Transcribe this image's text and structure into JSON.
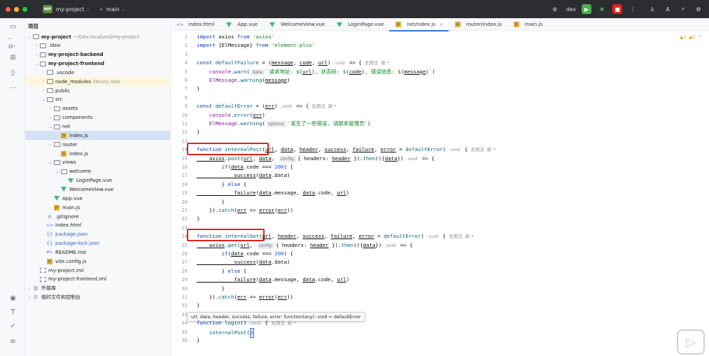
{
  "titlebar": {
    "project_badge": "MP",
    "project_name": "my-project",
    "branch": "main",
    "run_config": "dev",
    "colors": {
      "bg": "#2b2d30",
      "run": "#4caf50",
      "debug": "#e0231b"
    }
  },
  "project": {
    "title": "项目",
    "tree": [
      {
        "label": "my-project",
        "hint": "~/Dev.localized/my-project",
        "depth": 0,
        "kind": "folder",
        "chev": "open",
        "bold": true
      },
      {
        "label": ".idea",
        "depth": 1,
        "kind": "folder",
        "chev": "closed"
      },
      {
        "label": "my-project-backend",
        "depth": 1,
        "kind": "folder",
        "chev": "closed",
        "bold": true
      },
      {
        "label": "my-project-frontend",
        "depth": 1,
        "kind": "folder",
        "chev": "open",
        "bold": true
      },
      {
        "label": ".vscode",
        "depth": 2,
        "kind": "folder",
        "chev": "closed"
      },
      {
        "label": "node_modules",
        "hint": "library root",
        "depth": 2,
        "kind": "folder",
        "chev": "closed",
        "hl": true
      },
      {
        "label": "public",
        "depth": 2,
        "kind": "folder",
        "chev": "closed"
      },
      {
        "label": "src",
        "depth": 2,
        "kind": "folder",
        "chev": "open"
      },
      {
        "label": "assets",
        "depth": 3,
        "kind": "folder",
        "chev": "closed"
      },
      {
        "label": "components",
        "depth": 3,
        "kind": "folder",
        "chev": "closed"
      },
      {
        "label": "net",
        "depth": 3,
        "kind": "folder",
        "chev": "open"
      },
      {
        "label": "index.js",
        "depth": 4,
        "kind": "js",
        "sel": true
      },
      {
        "label": "router",
        "depth": 3,
        "kind": "folder",
        "chev": "open"
      },
      {
        "label": "index.js",
        "depth": 4,
        "kind": "js"
      },
      {
        "label": "views",
        "depth": 3,
        "kind": "folder",
        "chev": "open"
      },
      {
        "label": "welcome",
        "depth": 4,
        "kind": "folder",
        "chev": "open"
      },
      {
        "label": "LoginPage.vue",
        "depth": 5,
        "kind": "vue"
      },
      {
        "label": "WelcomeView.vue",
        "depth": 4,
        "kind": "vue"
      },
      {
        "label": "App.vue",
        "depth": 3,
        "kind": "vue"
      },
      {
        "label": "main.js",
        "depth": 3,
        "kind": "js"
      },
      {
        "label": ".gitignore",
        "depth": 2,
        "kind": "ignore"
      },
      {
        "label": "index.html",
        "depth": 2,
        "kind": "html"
      },
      {
        "label": "package.json",
        "depth": 2,
        "kind": "json",
        "blue": true
      },
      {
        "label": "package-lock.json",
        "depth": 2,
        "kind": "json",
        "blue": true
      },
      {
        "label": "README.md",
        "depth": 2,
        "kind": "md"
      },
      {
        "label": "vite.config.js",
        "depth": 2,
        "kind": "js"
      },
      {
        "label": "my-project.iml",
        "depth": 1,
        "kind": "iml"
      },
      {
        "label": "my-project-frontend.iml",
        "depth": 1,
        "kind": "iml"
      },
      {
        "label": "外部库",
        "depth": 0,
        "kind": "lib",
        "chev": "closed"
      },
      {
        "label": "临时文件和控制台",
        "depth": 0,
        "kind": "scratch",
        "chev": "closed"
      }
    ]
  },
  "tabs": [
    {
      "label": "index.html",
      "kind": "html"
    },
    {
      "label": "App.vue",
      "kind": "vue"
    },
    {
      "label": "WelcomeView.vue",
      "kind": "vue"
    },
    {
      "label": "LoginPage.vue",
      "kind": "vue"
    },
    {
      "label": "net/index.js",
      "kind": "js",
      "active": true
    },
    {
      "label": "router/index.js",
      "kind": "js"
    },
    {
      "label": "main.js",
      "kind": "js"
    }
  ],
  "editor": {
    "inspection": {
      "warnings": "▲3",
      "weak": "▲1"
    },
    "line_numbers": [
      "1",
      "2",
      "3",
      "4",
      "5",
      "6",
      "7",
      "8",
      "9",
      "10",
      "11",
      "12",
      "13",
      "14",
      "15",
      "16",
      "17",
      "18",
      "19",
      "20",
      "21",
      "22",
      "23",
      "24",
      "25",
      "26",
      "27",
      "28",
      "29",
      "30",
      "31",
      "32",
      "33",
      "34",
      "35",
      "36"
    ],
    "lines": [
      [
        {
          "t": "import ",
          "c": "kw"
        },
        {
          "t": "axios "
        },
        {
          "t": "from ",
          "c": "kw"
        },
        {
          "t": "'axios'",
          "c": "str"
        }
      ],
      [
        {
          "t": "import ",
          "c": "kw"
        },
        {
          "t": "{ElMessage} "
        },
        {
          "t": "from ",
          "c": "kw"
        },
        {
          "t": "'element-plus'",
          "c": "str"
        }
      ],
      [],
      [
        {
          "t": "const ",
          "c": "kw"
        },
        {
          "t": "defaultFailure",
          "c": "fn"
        },
        {
          "t": " = ("
        },
        {
          "t": "message",
          "c": "ul"
        },
        {
          "t": ", "
        },
        {
          "t": "code",
          "c": "ul"
        },
        {
          "t": ", "
        },
        {
          "t": "url",
          "c": "ul"
        },
        {
          "t": ")"
        },
        {
          "t": " : void ",
          "c": "inlay"
        },
        {
          "t": " => {"
        },
        {
          "t": "  无用法  新 *",
          "c": "inlay"
        }
      ],
      [
        {
          "t": "    console",
          "c": "pur"
        },
        {
          "t": "."
        },
        {
          "t": "warn",
          "c": "fn"
        },
        {
          "t": "("
        },
        {
          "h": "data:"
        },
        {
          "t": "`请求地址: ${",
          "c": "str"
        },
        {
          "t": "url",
          "c": "ul"
        },
        {
          "t": "}, 状态码: ${",
          "c": "str"
        },
        {
          "t": "code",
          "c": "ul"
        },
        {
          "t": "}, 错误信息: ${",
          "c": "str"
        },
        {
          "t": "message",
          "c": "ul"
        },
        {
          "t": "}`",
          "c": "str"
        },
        {
          "t": ")"
        }
      ],
      [
        {
          "t": "    ElMessage",
          "c": "pur"
        },
        {
          "t": "."
        },
        {
          "t": "warning",
          "c": "fn"
        },
        {
          "t": "("
        },
        {
          "t": "message",
          "c": "ul"
        },
        {
          "t": ")"
        }
      ],
      [
        {
          "t": "}"
        }
      ],
      [],
      [
        {
          "t": "const ",
          "c": "kw"
        },
        {
          "t": "defaultError",
          "c": "fn"
        },
        {
          "t": " = ("
        },
        {
          "t": "err",
          "c": "ul"
        },
        {
          "t": ")"
        },
        {
          "t": " : void ",
          "c": "inlay"
        },
        {
          "t": " => {"
        },
        {
          "t": "  无用法  新 *",
          "c": "inlay"
        }
      ],
      [
        {
          "t": "    console",
          "c": "pur"
        },
        {
          "t": "."
        },
        {
          "t": "error",
          "c": "fn"
        },
        {
          "t": "("
        },
        {
          "t": "err",
          "c": "ul"
        },
        {
          "t": ")"
        }
      ],
      [
        {
          "t": "    ElMessage",
          "c": "pur"
        },
        {
          "t": "."
        },
        {
          "t": "warning",
          "c": "fn"
        },
        {
          "t": "("
        },
        {
          "h": "options:"
        },
        {
          "t": "'发生了一些错误, 请联系管理员'",
          "c": "str"
        },
        {
          "t": ")"
        }
      ],
      [
        {
          "t": "}"
        }
      ],
      [],
      [
        {
          "t": "function ",
          "c": "kw"
        },
        {
          "t": "internalPost",
          "c": "fn"
        },
        {
          "t": "("
        },
        {
          "t": "url",
          "c": "ul"
        },
        {
          "t": ", "
        },
        {
          "t": "data",
          "c": "ul"
        },
        {
          "t": ", "
        },
        {
          "t": "header",
          "c": "ul"
        },
        {
          "t": ", "
        },
        {
          "t": "success",
          "c": "ul"
        },
        {
          "t": ", "
        },
        {
          "t": "failure",
          "c": "ul"
        },
        {
          "t": ", "
        },
        {
          "t": "error",
          "c": "ul"
        },
        {
          "t": " = "
        },
        {
          "t": "defaultError",
          "c": "fn"
        },
        {
          "t": ")"
        },
        {
          "t": " : void ",
          "c": "inlay"
        },
        {
          "t": " {"
        },
        {
          "t": "  无用法  新 *",
          "c": "inlay"
        }
      ],
      [
        {
          "t": "    axios",
          "c": "ul"
        },
        {
          "t": "."
        },
        {
          "t": "post",
          "c": "fn"
        },
        {
          "t": "("
        },
        {
          "t": "url",
          "c": "ul"
        },
        {
          "t": ", "
        },
        {
          "t": "data",
          "c": "ul"
        },
        {
          "t": ", "
        },
        {
          "h": "config:"
        },
        {
          "t": "{ headers: "
        },
        {
          "t": "header",
          "c": "ul"
        },
        {
          "t": " })."
        },
        {
          "t": "then",
          "c": "fn"
        },
        {
          "t": "(({"
        },
        {
          "t": "data",
          "c": "ul"
        },
        {
          "t": "})"
        },
        {
          "t": " : void ",
          "c": "inlay"
        },
        {
          "t": " => {"
        }
      ],
      [
        {
          "t": "        if",
          "c": "kw"
        },
        {
          "t": "("
        },
        {
          "t": "data",
          "c": "ul"
        },
        {
          "t": ".code === "
        },
        {
          "t": "200",
          "c": "num"
        },
        {
          "t": ") {"
        }
      ],
      [
        {
          "t": "            success",
          "c": "ul"
        },
        {
          "t": "("
        },
        {
          "t": "data",
          "c": "ul"
        },
        {
          "t": ".data)"
        }
      ],
      [
        {
          "t": "        } "
        },
        {
          "t": "else ",
          "c": "kw"
        },
        {
          "t": "{"
        }
      ],
      [
        {
          "t": "            failure",
          "c": "ul"
        },
        {
          "t": "("
        },
        {
          "t": "data",
          "c": "ul"
        },
        {
          "t": ".message, "
        },
        {
          "t": "data",
          "c": "ul"
        },
        {
          "t": ".code, "
        },
        {
          "t": "url",
          "c": "ul"
        },
        {
          "t": ")"
        }
      ],
      [
        {
          "t": "        }"
        }
      ],
      [
        {
          "t": "    })."
        },
        {
          "t": "catch",
          "c": "fn"
        },
        {
          "t": "("
        },
        {
          "t": "err",
          "c": "ul"
        },
        {
          "t": " => "
        },
        {
          "t": "error",
          "c": "ul"
        },
        {
          "t": "("
        },
        {
          "t": "err",
          "c": "ul"
        },
        {
          "t": "))"
        }
      ],
      [
        {
          "t": "}"
        }
      ],
      [],
      [
        {
          "t": "function ",
          "c": "kw"
        },
        {
          "t": "internalGet",
          "c": "fn"
        },
        {
          "t": "("
        },
        {
          "t": "url",
          "c": "ul"
        },
        {
          "t": ", "
        },
        {
          "t": "header",
          "c": "ul"
        },
        {
          "t": ", "
        },
        {
          "t": "success",
          "c": "ul"
        },
        {
          "t": ", "
        },
        {
          "t": "failure",
          "c": "ul"
        },
        {
          "t": ", "
        },
        {
          "t": "error",
          "c": "ul"
        },
        {
          "t": " = "
        },
        {
          "t": "defaultError",
          "c": "fn"
        },
        {
          "t": ")"
        },
        {
          "t": " : void ",
          "c": "inlay"
        },
        {
          "t": " {"
        },
        {
          "t": "  无用法  新 *",
          "c": "inlay"
        }
      ],
      [
        {
          "t": "    axios",
          "c": "ul"
        },
        {
          "t": "."
        },
        {
          "t": "get",
          "c": "fn"
        },
        {
          "t": "("
        },
        {
          "t": "url",
          "c": "ul"
        },
        {
          "t": ", "
        },
        {
          "h": "config:"
        },
        {
          "t": "{ headers: "
        },
        {
          "t": "header",
          "c": "ul"
        },
        {
          "t": " })."
        },
        {
          "t": "then",
          "c": "fn"
        },
        {
          "t": "(({"
        },
        {
          "t": "data",
          "c": "ul"
        },
        {
          "t": "})"
        },
        {
          "t": " : void ",
          "c": "inlay"
        },
        {
          "t": " => {"
        }
      ],
      [
        {
          "t": "        if",
          "c": "kw"
        },
        {
          "t": "("
        },
        {
          "t": "data",
          "c": "ul"
        },
        {
          "t": ".code === "
        },
        {
          "t": "200",
          "c": "num"
        },
        {
          "t": ") {"
        }
      ],
      [
        {
          "t": "            success",
          "c": "ul"
        },
        {
          "t": "("
        },
        {
          "t": "data",
          "c": "ul"
        },
        {
          "t": ".data)"
        }
      ],
      [
        {
          "t": "        } "
        },
        {
          "t": "else ",
          "c": "kw"
        },
        {
          "t": "{"
        }
      ],
      [
        {
          "t": "            failure",
          "c": "ul"
        },
        {
          "t": "("
        },
        {
          "t": "data",
          "c": "ul"
        },
        {
          "t": ".message, "
        },
        {
          "t": "data",
          "c": "ul"
        },
        {
          "t": ".code, "
        },
        {
          "t": "url",
          "c": "ul"
        },
        {
          "t": ")"
        }
      ],
      [
        {
          "t": "        }"
        }
      ],
      [
        {
          "t": "    })."
        },
        {
          "t": "catch",
          "c": "fn"
        },
        {
          "t": "("
        },
        {
          "t": "err",
          "c": "ul"
        },
        {
          "t": " => "
        },
        {
          "t": "error",
          "c": "ul"
        },
        {
          "t": "("
        },
        {
          "t": "err",
          "c": "ul"
        },
        {
          "t": "))"
        }
      ],
      [
        {
          "t": "}"
        }
      ],
      [],
      [
        {
          "t": "function ",
          "c": "kw"
        },
        {
          "t": "login",
          "c": "fn"
        },
        {
          "t": "()"
        },
        {
          "t": " : void ",
          "c": "inlay"
        },
        {
          "t": " {"
        },
        {
          "t": "  无用法  新 *",
          "c": "inlay"
        }
      ],
      [
        {
          "t": "    internalPost",
          "c": "fn"
        },
        {
          "t": "("
        },
        {
          "cur": ")"
        }
      ],
      [
        {
          "t": "}"
        }
      ]
    ],
    "tooltip": "url, data, header, success, failure, error: function(any): void = defaultError"
  }
}
